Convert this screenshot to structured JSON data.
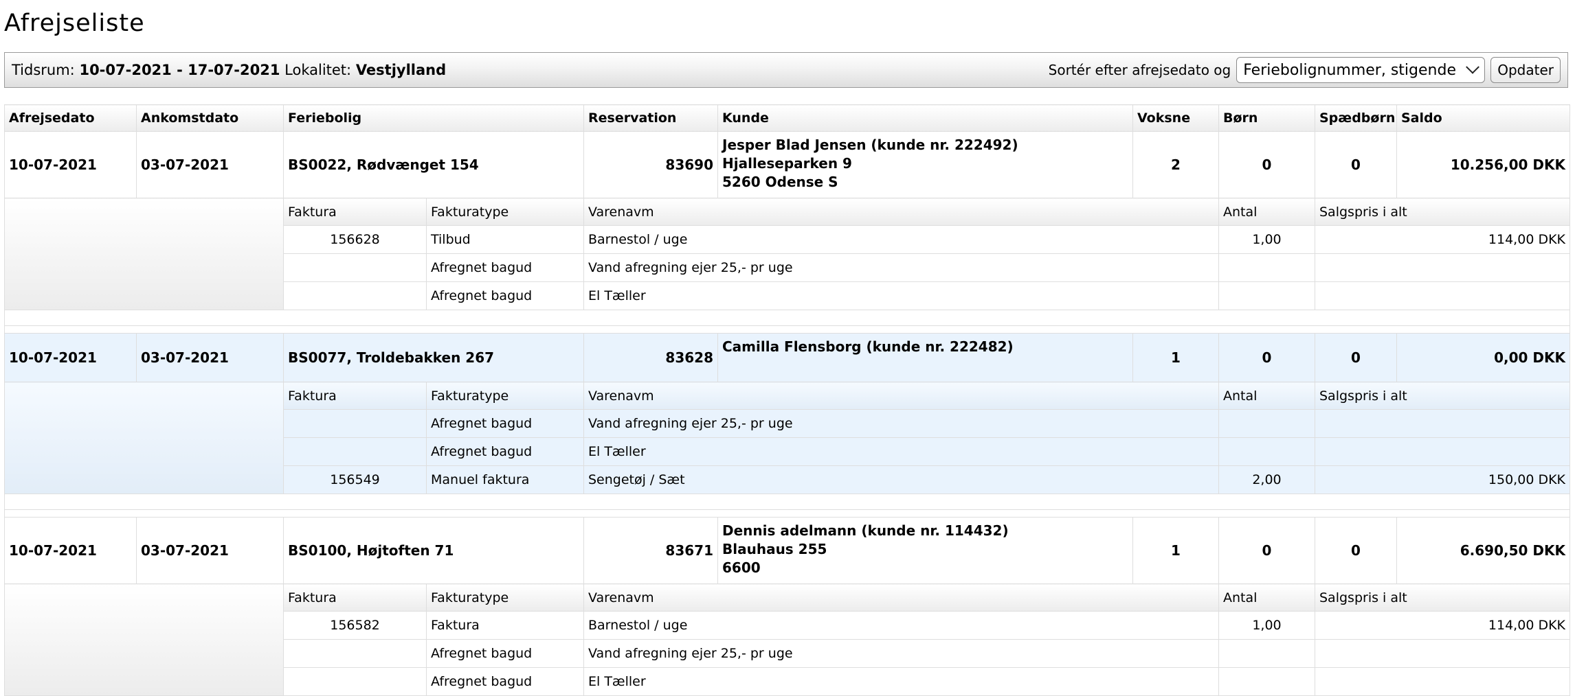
{
  "page": {
    "title": "Afrejseliste"
  },
  "filter": {
    "period_label": "Tidsrum:",
    "period_value": "10-07-2021 - 17-07-2021",
    "location_label": "Lokalitet:",
    "location_value": "Vestjylland",
    "sort_label": "Sortér efter afrejsedato og",
    "sort_selected": "Feriebolignummer, stigende",
    "update_label": "Opdater"
  },
  "columns": [
    "Afrejsedato",
    "Ankomstdato",
    "Feriebolig",
    "Reservation",
    "Kunde",
    "Voksne",
    "Børn",
    "Spædbørn",
    "Saldo"
  ],
  "sub_columns": [
    "Faktura",
    "Fakturatype",
    "Varenavm",
    "Antal",
    "Salgspris i alt"
  ],
  "rows": [
    {
      "departure": "10-07-2021",
      "arrival": "03-07-2021",
      "house": "BS0022, Rødvænget 154",
      "reservation": "83690",
      "customer": [
        "Jesper Blad Jensen (kunde nr. 222492)",
        "Hjalleseparken 9",
        "5260 Odense S"
      ],
      "adults": "2",
      "children": "0",
      "infants": "0",
      "balance": "10.256,00 DKK",
      "items": [
        {
          "invoice": "156628",
          "type": "Tilbud",
          "name": "Barnestol / uge",
          "qty": "1,00",
          "price": "114,00 DKK"
        },
        {
          "invoice": "",
          "type": "Afregnet bagud",
          "name": "Vand afregning ejer 25,- pr uge",
          "qty": "",
          "price": ""
        },
        {
          "invoice": "",
          "type": "Afregnet bagud",
          "name": "El Tæller",
          "qty": "",
          "price": ""
        }
      ]
    },
    {
      "departure": "10-07-2021",
      "arrival": "03-07-2021",
      "house": "BS0077, Troldebakken 267",
      "reservation": "83628",
      "customer": [
        "Camilla Flensborg (kunde nr. 222482)"
      ],
      "adults": "1",
      "children": "0",
      "infants": "0",
      "balance": "0,00 DKK",
      "items": [
        {
          "invoice": "",
          "type": "Afregnet bagud",
          "name": "Vand afregning ejer 25,- pr uge",
          "qty": "",
          "price": ""
        },
        {
          "invoice": "",
          "type": "Afregnet bagud",
          "name": "El Tæller",
          "qty": "",
          "price": ""
        },
        {
          "invoice": "156549",
          "type": "Manuel faktura",
          "name": "Sengetøj / Sæt",
          "qty": "2,00",
          "price": "150,00 DKK"
        }
      ]
    },
    {
      "departure": "10-07-2021",
      "arrival": "03-07-2021",
      "house": "BS0100, Højtoften 71",
      "reservation": "83671",
      "customer": [
        "Dennis adelmann (kunde nr. 114432)",
        "Blauhaus 255",
        "6600"
      ],
      "adults": "1",
      "children": "0",
      "infants": "0",
      "balance": "6.690,50 DKK",
      "items": [
        {
          "invoice": "156582",
          "type": "Faktura",
          "name": "Barnestol / uge",
          "qty": "1,00",
          "price": "114,00 DKK"
        },
        {
          "invoice": "",
          "type": "Afregnet bagud",
          "name": "Vand afregning ejer 25,- pr uge",
          "qty": "",
          "price": ""
        },
        {
          "invoice": "",
          "type": "Afregnet bagud",
          "name": "El Tæller",
          "qty": "",
          "price": ""
        }
      ]
    }
  ]
}
